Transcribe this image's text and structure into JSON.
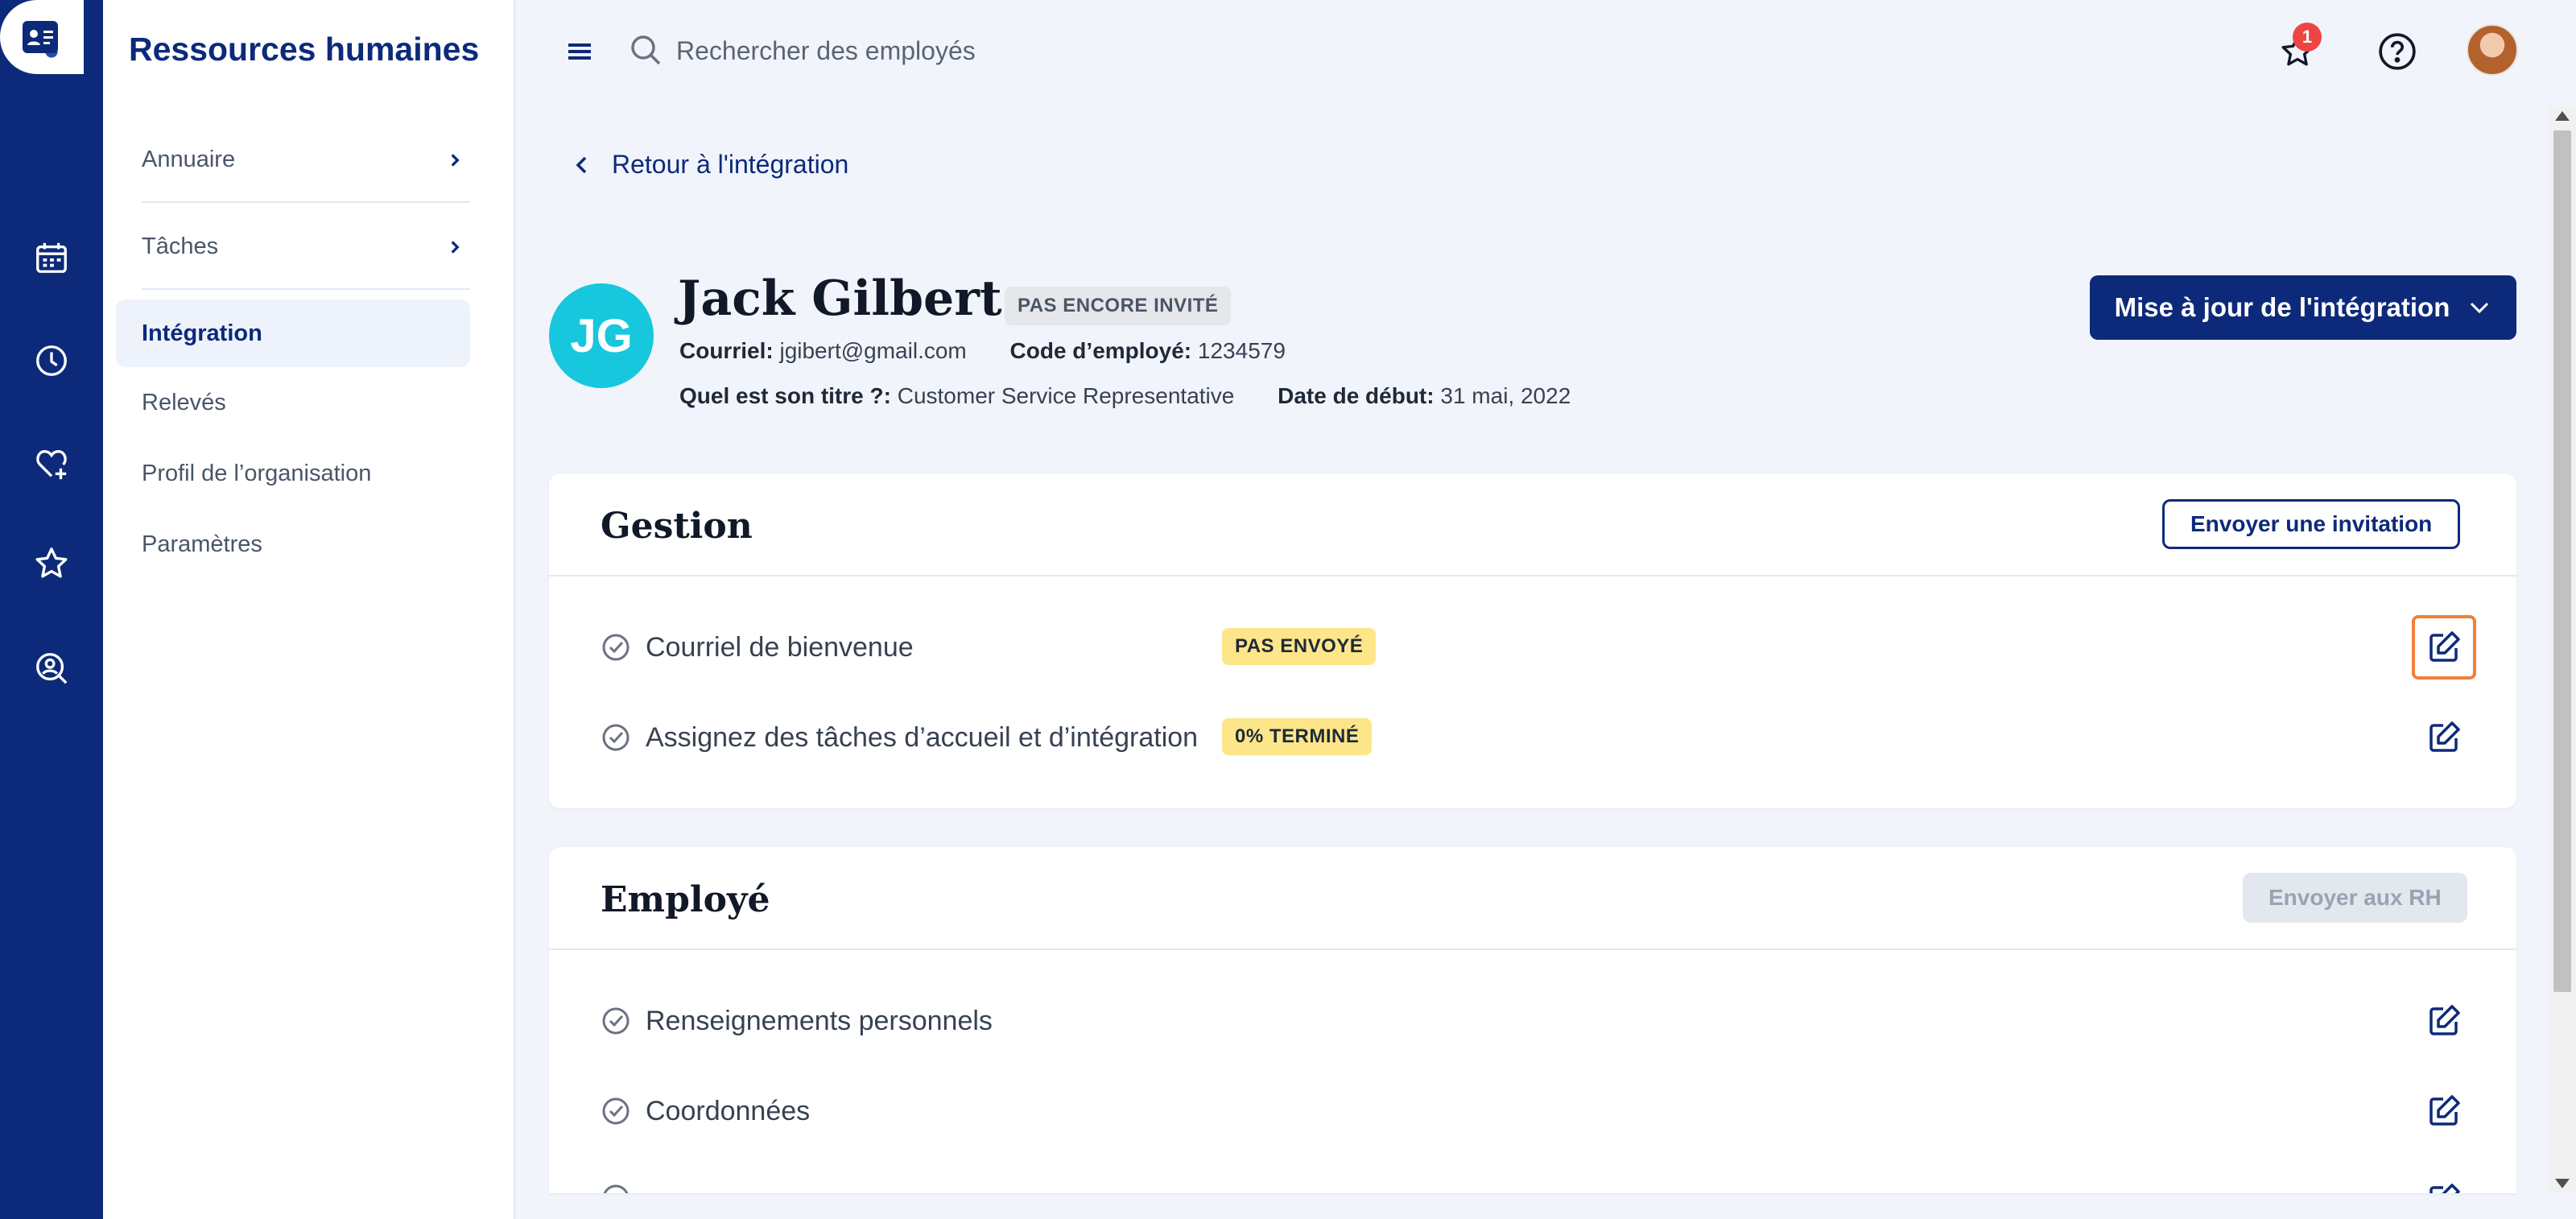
{
  "app": {
    "title": "Ressources humaines"
  },
  "sidebar": {
    "items": [
      {
        "label": "Annuaire"
      },
      {
        "label": "Tâches"
      },
      {
        "label": "Intégration"
      },
      {
        "label": "Relevés"
      },
      {
        "label": "Profil de l’organisation"
      },
      {
        "label": "Paramètres"
      }
    ]
  },
  "rail": {
    "icons": [
      "logo-icon",
      "directory-card-icon",
      "calendar-icon",
      "clock-icon",
      "heart-plus-icon",
      "star-icon",
      "person-search-icon"
    ]
  },
  "topbar": {
    "search_placeholder": "Rechercher des employés",
    "notification_count": "1"
  },
  "page": {
    "back_label": "Retour à l'intégration",
    "update_button": "Mise à jour de l'intégration"
  },
  "employee": {
    "initials": "JG",
    "name": "Jack Gilbert",
    "status": "PAS ENCORE INVITÉ",
    "email_label": "Courriel:",
    "email": "jgibert@gmail.com",
    "code_label": "Code d’employé:",
    "code": "1234579",
    "title_label": "Quel est son titre ?:",
    "title": "Customer Service Representative",
    "start_label": "Date de début:",
    "start_date": "31 mai, 2022"
  },
  "gestion": {
    "title": "Gestion",
    "action": "Envoyer une invitation",
    "rows": [
      {
        "label": "Courriel de bienvenue",
        "status": "PAS ENVOYÉ"
      },
      {
        "label": "Assignez des tâches d’accueil et d’intégration",
        "status": "0% TERMINÉ"
      }
    ]
  },
  "employe": {
    "title": "Employé",
    "action": "Envoyer aux RH",
    "rows": [
      {
        "label": "Renseignements personnels"
      },
      {
        "label": "Coordonnées"
      }
    ]
  },
  "colors": {
    "brand": "#0d2a7a",
    "avatar": "#17c7dd",
    "warning_pill": "#fde68a",
    "focus": "#f0803c",
    "badge": "#ef4444"
  }
}
